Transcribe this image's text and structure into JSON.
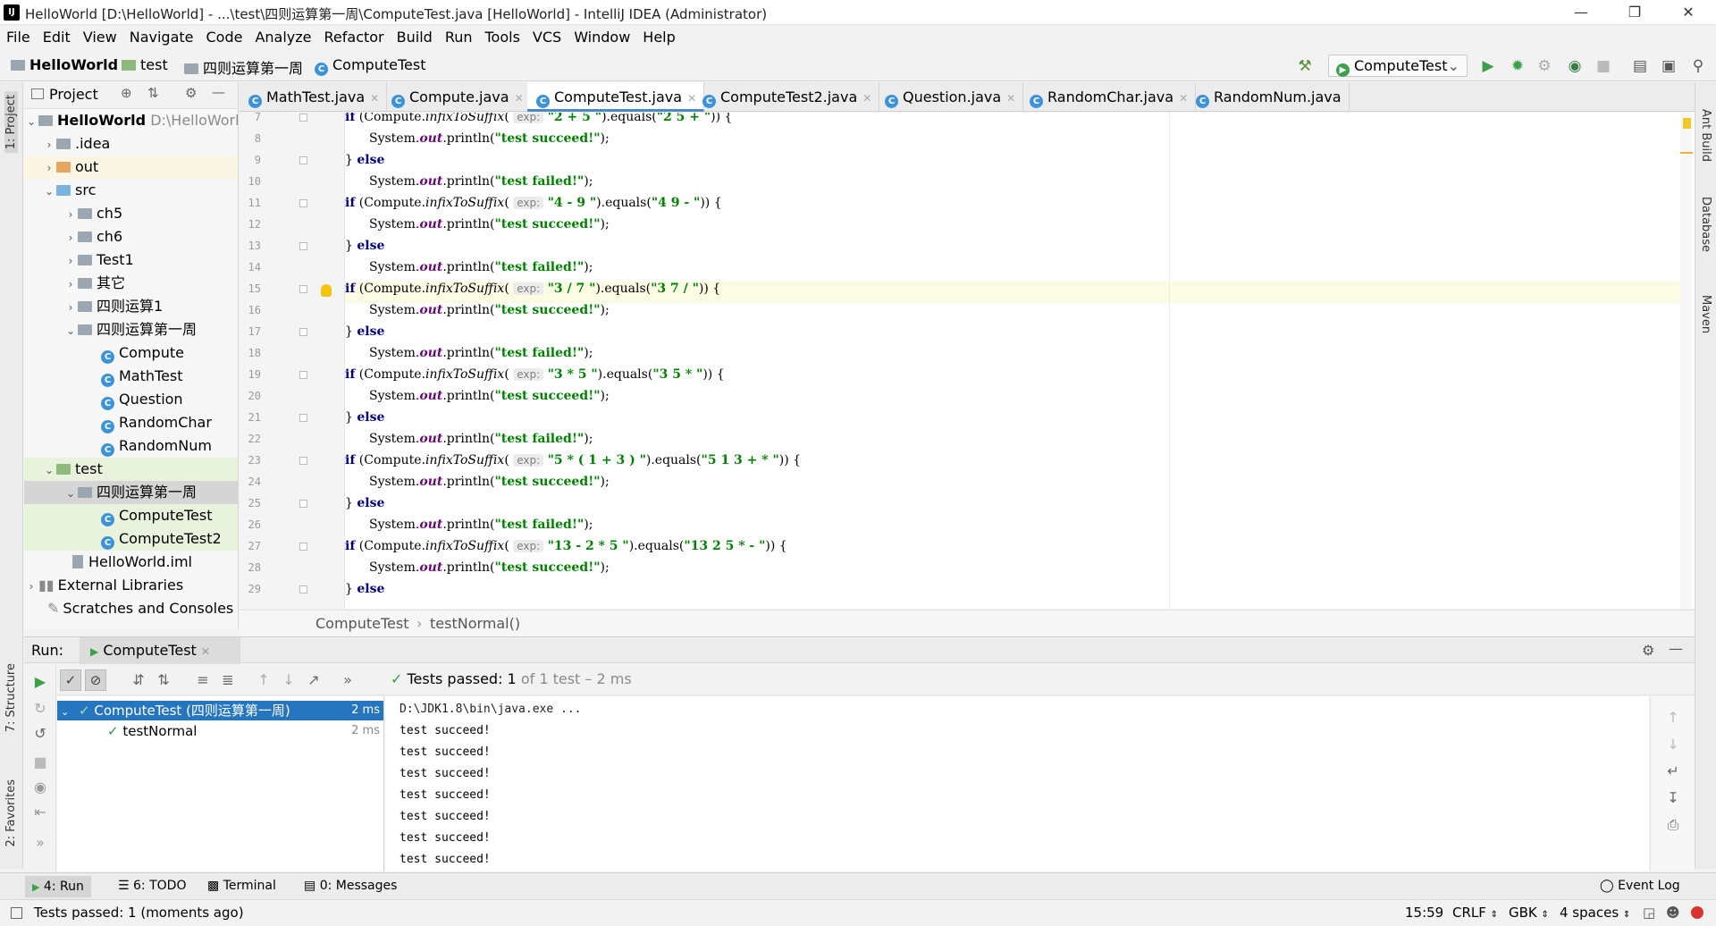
{
  "window": {
    "title": "HelloWorld [D:\\HelloWorld] - ...\\test\\四则运算第一周\\ComputeTest.java [HelloWorld] - IntelliJ IDEA (Administrator)",
    "app_icon": "IJ"
  },
  "menu": [
    "File",
    "Edit",
    "View",
    "Navigate",
    "Code",
    "Analyze",
    "Refactor",
    "Build",
    "Run",
    "Tools",
    "VCS",
    "Window",
    "Help"
  ],
  "navbar": {
    "crumbs": [
      "HelloWorld",
      "test",
      "四则运算第一周",
      "ComputeTest"
    ],
    "run_config": "ComputeTest"
  },
  "left_stripe": {
    "project": "1: Project",
    "structure": "7: Structure",
    "favorites": "2: Favorites"
  },
  "right_stripe": {
    "ant": "Ant Build",
    "database": "Database",
    "maven": "Maven"
  },
  "project_panel": {
    "title": "Project",
    "tree": [
      {
        "label": "HelloWorld",
        "extra": "D:\\HelloWorld"
      },
      {
        "label": ".idea"
      },
      {
        "label": "out"
      },
      {
        "label": "src"
      },
      {
        "label": "ch5"
      },
      {
        "label": "ch6"
      },
      {
        "label": "Test1"
      },
      {
        "label": "其它"
      },
      {
        "label": "四则运算1"
      },
      {
        "label": "四则运算第一周"
      },
      {
        "label": "Compute"
      },
      {
        "label": "MathTest"
      },
      {
        "label": "Question"
      },
      {
        "label": "RandomChar"
      },
      {
        "label": "RandomNum"
      },
      {
        "label": "test"
      },
      {
        "label": "四则运算第一周"
      },
      {
        "label": "ComputeTest"
      },
      {
        "label": "ComputeTest2"
      },
      {
        "label": "HelloWorld.iml"
      },
      {
        "label": "External Libraries"
      },
      {
        "label": "Scratches and Consoles"
      }
    ]
  },
  "tabs": [
    "MathTest.java",
    "Compute.java",
    "ComputeTest.java",
    "ComputeTest2.java",
    "Question.java",
    "RandomChar.java",
    "RandomNum.java"
  ],
  "editor": {
    "hint": "exp:",
    "kw_if": "if",
    "kw_else": "else",
    "call_prefix": "(Compute.",
    "method": "infixToSuffix",
    "equals": ").equals(",
    "print_prefix": "System.",
    "print_field": "out",
    "print_method": ".println(",
    "succeed": "\"test succeed!\"",
    "failed": "\"test failed!\"",
    "lines": [
      {
        "n": "7"
      },
      {
        "n": "8"
      },
      {
        "n": "9"
      },
      {
        "n": "10"
      },
      {
        "n": "11"
      },
      {
        "n": "12"
      },
      {
        "n": "13"
      },
      {
        "n": "14"
      },
      {
        "n": "15"
      },
      {
        "n": "16"
      },
      {
        "n": "17"
      },
      {
        "n": "18"
      },
      {
        "n": "19"
      },
      {
        "n": "20"
      },
      {
        "n": "21"
      },
      {
        "n": "22"
      },
      {
        "n": "23"
      },
      {
        "n": "24"
      },
      {
        "n": "25"
      },
      {
        "n": "26"
      },
      {
        "n": "27"
      },
      {
        "n": "28"
      },
      {
        "n": "29"
      }
    ],
    "cases": [
      {
        "input": "\"2 + 5 \"",
        "expected": "\"2 5 + \""
      },
      {
        "input": "\"4 - 9 \"",
        "expected": "\"4 9 - \""
      },
      {
        "input": "\"3 / 7 \"",
        "expected": "\"3 7 / \""
      },
      {
        "input": "\"3 * 5 \"",
        "expected": "\"3 5 * \""
      },
      {
        "input": "\"5 * ( 1 + 3 ) \"",
        "expected": "\"5 1 3 + * \""
      },
      {
        "input": "\"13 - 2 * 5 \"",
        "expected": "\"13 2 5 * - \""
      }
    ]
  },
  "breadcrumb": [
    "ComputeTest",
    "testNormal()"
  ],
  "run": {
    "label": "Run:",
    "tab": "ComputeTest",
    "status": "Tests passed:",
    "passed": "1",
    "status_rest": "of 1 test – 2 ms",
    "tree": [
      {
        "label": "ComputeTest (四则运算第一周)",
        "time": "2 ms"
      },
      {
        "label": "testNormal",
        "time": "2 ms"
      }
    ],
    "console": [
      "D:\\JDK1.8\\bin\\java.exe ...",
      "test succeed!",
      "test succeed!",
      "test succeed!",
      "test succeed!",
      "test succeed!",
      "test succeed!",
      "test succeed!"
    ]
  },
  "tool_buttons": {
    "run": "4: Run",
    "todo": "6: TODO",
    "terminal": "Terminal",
    "messages": "0: Messages",
    "event_log": "Event Log"
  },
  "status": {
    "message": "Tests passed: 1 (moments ago)",
    "position": "15:59",
    "line_sep": "CRLF",
    "encoding": "GBK",
    "indent": "4 spaces"
  },
  "colors": {
    "accent": "#2675bf",
    "keyword": "#000080",
    "string": "#008000",
    "field": "#660e7a",
    "pass": "#2e9c48"
  }
}
